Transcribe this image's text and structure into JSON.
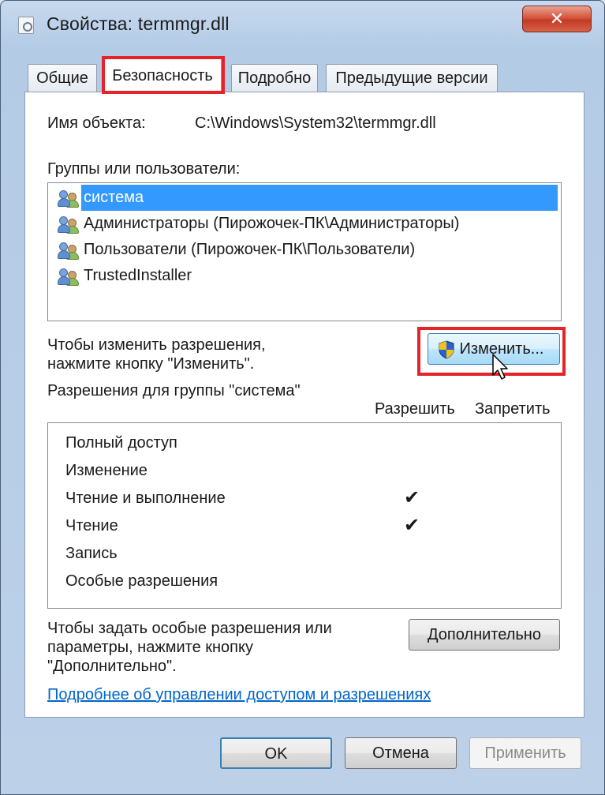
{
  "window": {
    "title": "Свойства: termmgr.dll",
    "close_label": "✕"
  },
  "tabs": [
    {
      "label": "Общие"
    },
    {
      "label": "Безопасность",
      "active": true
    },
    {
      "label": "Подробно"
    },
    {
      "label": "Предыдущие версии"
    }
  ],
  "object": {
    "label": "Имя объекта:",
    "value": "C:\\Windows\\System32\\termmgr.dll"
  },
  "groups": {
    "label": "Группы или пользователи:",
    "items": [
      {
        "name": "система",
        "selected": true
      },
      {
        "name": "Администраторы (Пирожочек-ПК\\Администраторы)"
      },
      {
        "name": "Пользователи (Пирожочек-ПК\\Пользователи)"
      },
      {
        "name": "TrustedInstaller"
      }
    ]
  },
  "change": {
    "hint_line1": "Чтобы изменить разрешения,",
    "hint_line2": "нажмите кнопку \"Изменить\".",
    "button_label": "Изменить..."
  },
  "permissions": {
    "label": "Разрешения для группы \"система\"",
    "allow_header": "Разрешить",
    "deny_header": "Запретить",
    "rows": [
      {
        "name": "Полный доступ",
        "allow": false,
        "deny": false
      },
      {
        "name": "Изменение",
        "allow": false,
        "deny": false
      },
      {
        "name": "Чтение и выполнение",
        "allow": true,
        "deny": false
      },
      {
        "name": "Чтение",
        "allow": true,
        "deny": false
      },
      {
        "name": "Запись",
        "allow": false,
        "deny": false
      },
      {
        "name": "Особые разрешения",
        "allow": false,
        "deny": false
      }
    ],
    "check_glyph": "✔"
  },
  "advanced": {
    "hint_line1": "Чтобы задать особые разрешения или",
    "hint_line2": "параметры, нажмите кнопку",
    "hint_line3": "\"Дополнительно\".",
    "button_label": "Дополнительно"
  },
  "help_link": "Подробнее об управлении доступом и разрешениях",
  "footer": {
    "ok_label": "OK",
    "cancel_label": "Отмена",
    "apply_label": "Применить"
  },
  "colors": {
    "highlight": "#e4232b",
    "selection": "#3399ff",
    "link": "#0066cc"
  }
}
